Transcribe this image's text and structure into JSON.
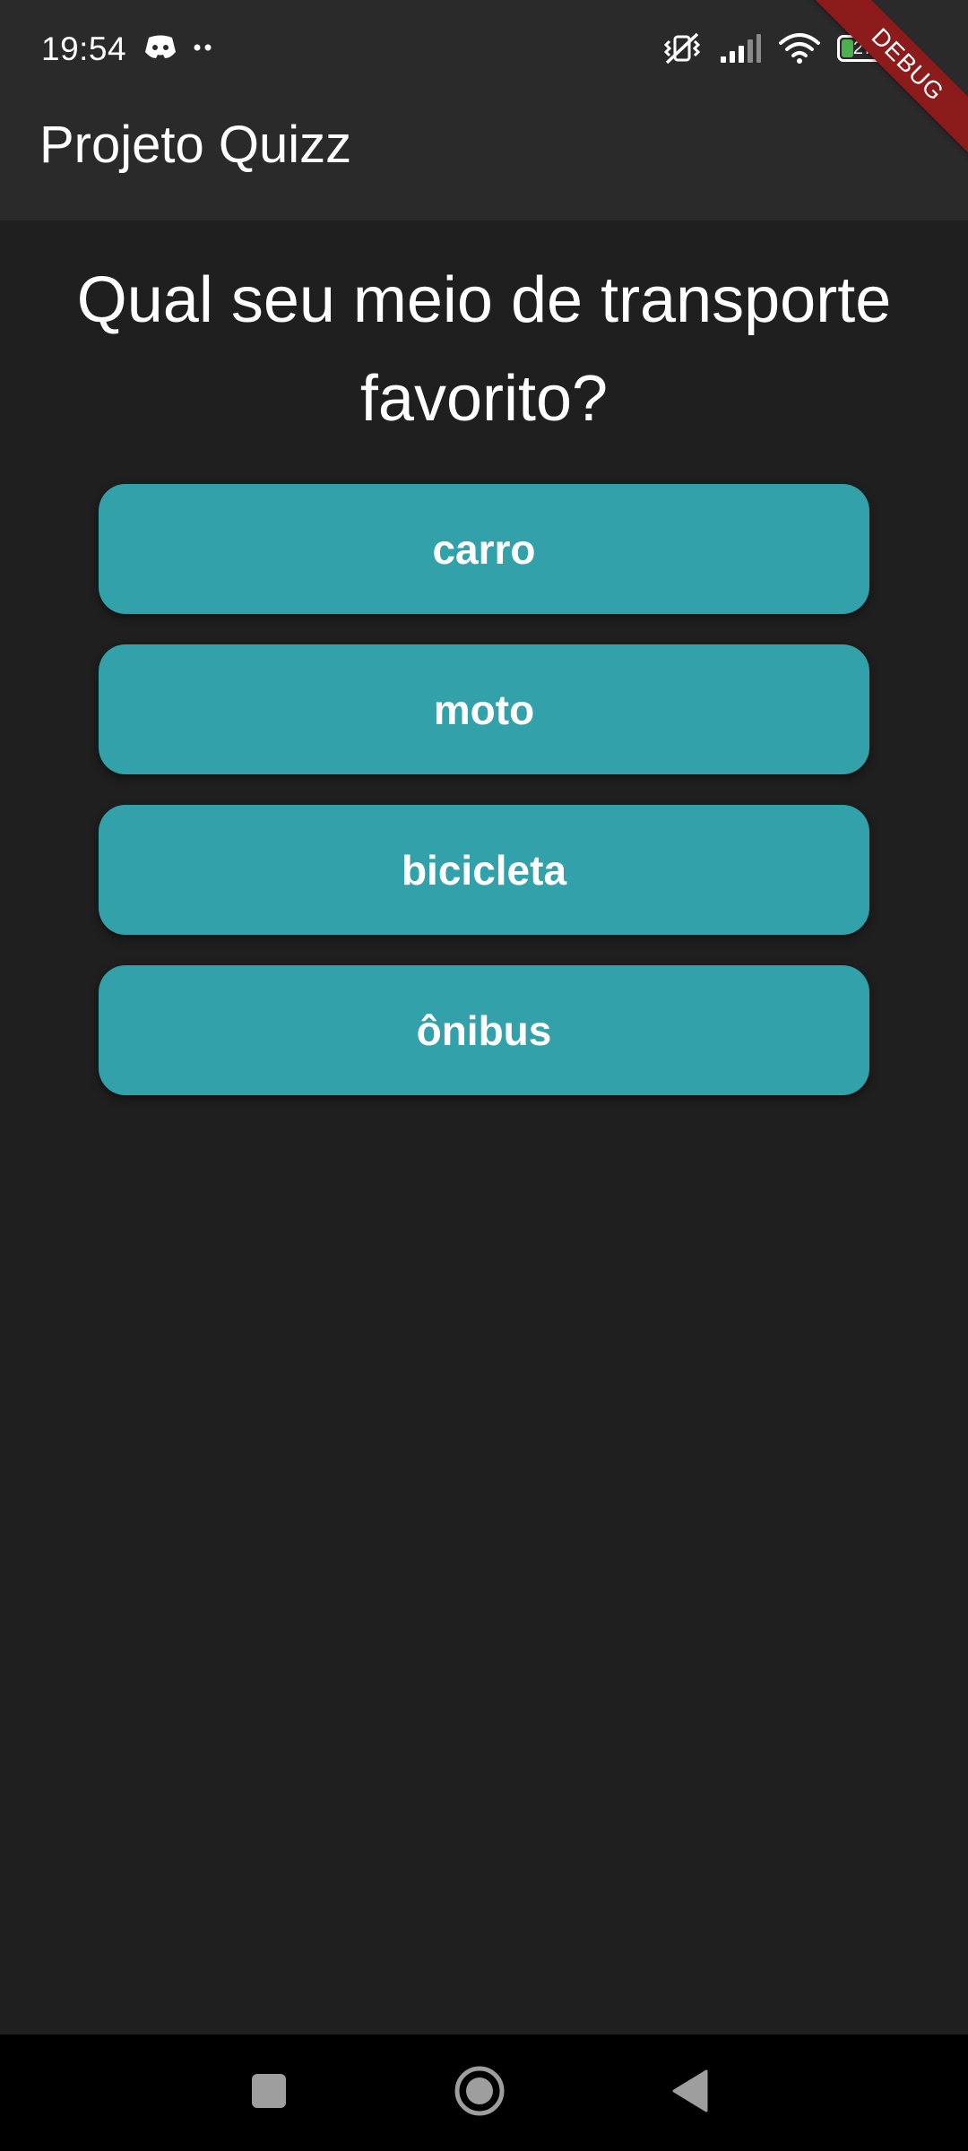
{
  "status_bar": {
    "time": "19:54",
    "battery_level": "27",
    "battery_fraction": 0.27,
    "left_icons": [
      "discord-notification-icon",
      "more-notifications-icon"
    ],
    "right_icons": [
      "vibrate-off-icon",
      "cellular-signal-icon",
      "wifi-icon",
      "battery-icon"
    ]
  },
  "debug_banner": {
    "label": "DEBUG",
    "color": "#8e1b1b"
  },
  "app_bar": {
    "title": "Projeto Quizz"
  },
  "quiz": {
    "question": "Qual seu meio de transporte favorito?",
    "answers": [
      "carro",
      "moto",
      "bicicleta",
      "ônibus"
    ],
    "button_color": "#32a1aa"
  },
  "nav_bar": {
    "buttons": [
      "recents-button",
      "home-button",
      "back-button"
    ]
  },
  "colors": {
    "background": "#1f1f1f",
    "app_bar": "#2a2a2a",
    "accent": "#32a1aa",
    "battery_fill": "#4caf50"
  }
}
